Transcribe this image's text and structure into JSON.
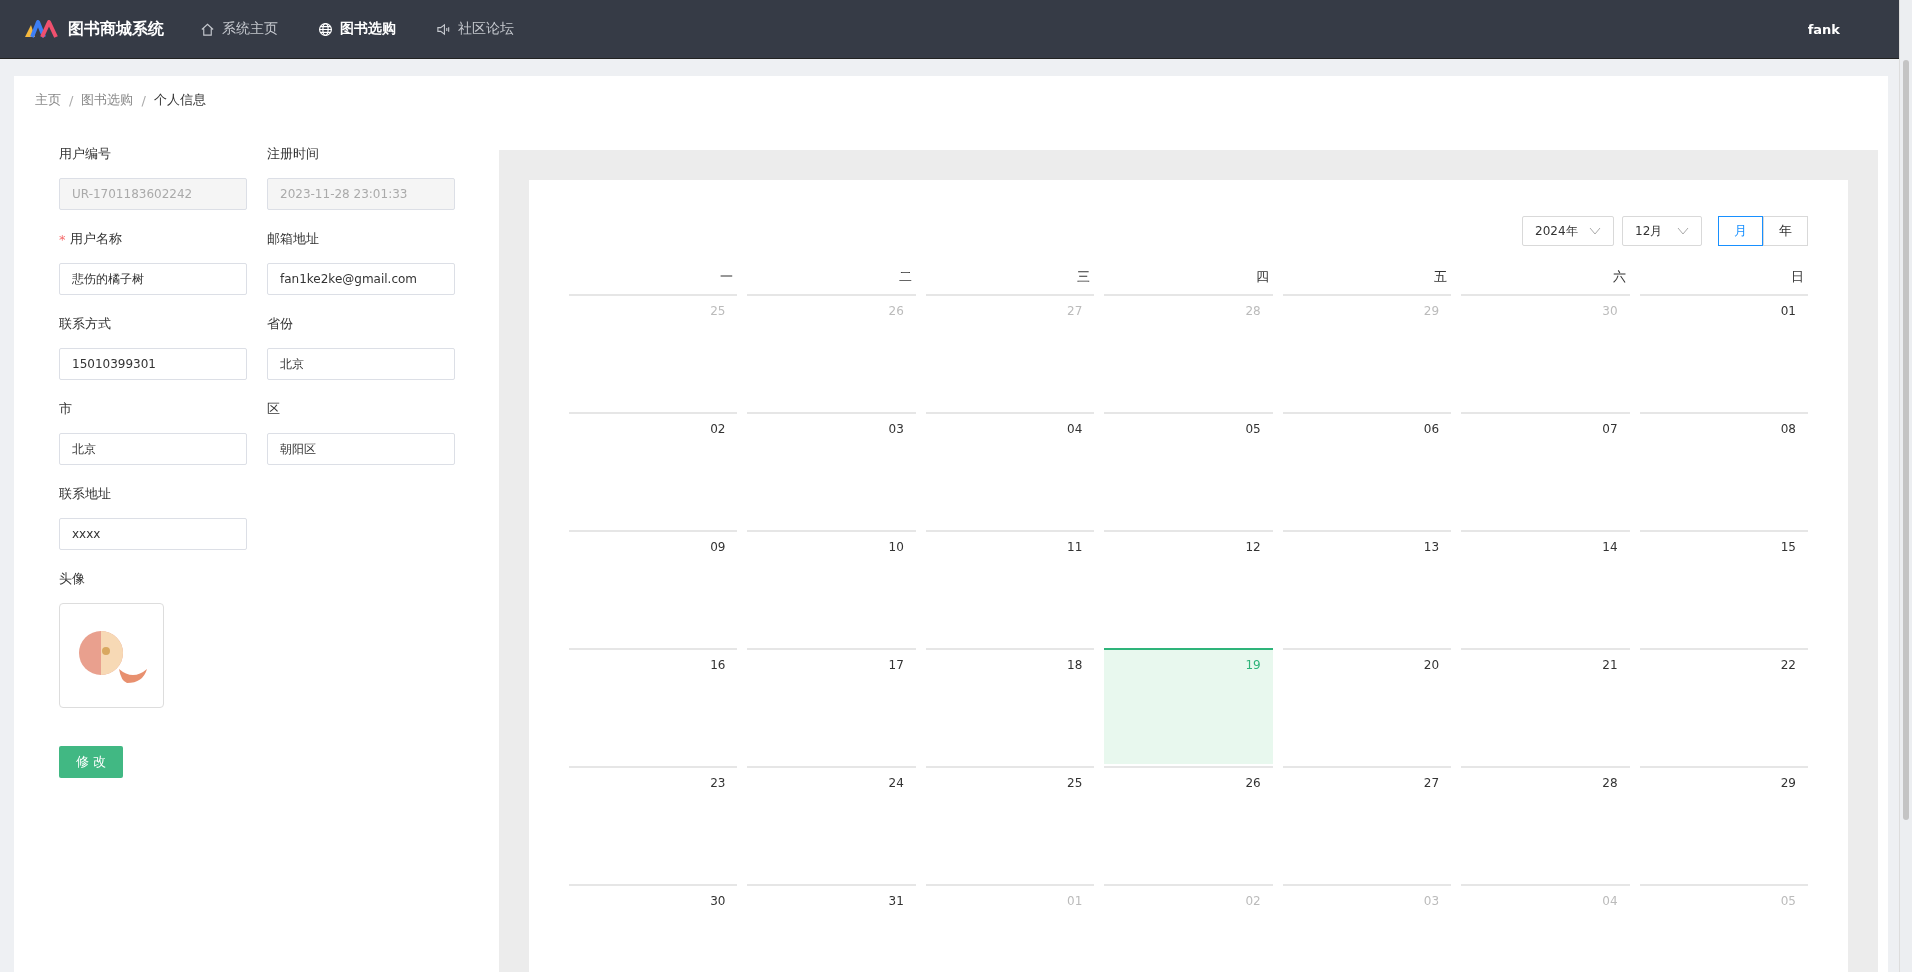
{
  "header": {
    "brand": "图书商城系统",
    "nav": [
      {
        "label": "系统主页",
        "selected": false
      },
      {
        "label": "图书选购",
        "selected": true
      },
      {
        "label": "社区论坛",
        "selected": false
      }
    ],
    "user": "fank"
  },
  "breadcrumb": {
    "items": [
      "主页",
      "图书选购",
      "个人信息"
    ],
    "separator": "/"
  },
  "form": {
    "required_mark": "*",
    "rows": [
      [
        {
          "label": "用户编号",
          "value": "UR-1701183602242",
          "disabled": true,
          "required": false
        },
        {
          "label": "注册时间",
          "value": "2023-11-28 23:01:33",
          "disabled": true,
          "required": false
        }
      ],
      [
        {
          "label": "用户名称",
          "value": "悲伤的橘子树",
          "disabled": false,
          "required": true
        },
        {
          "label": "邮箱地址",
          "value": "fan1ke2ke@gmail.com",
          "disabled": false,
          "required": false
        }
      ],
      [
        {
          "label": "联系方式",
          "value": "15010399301",
          "disabled": false,
          "required": false
        },
        {
          "label": "省份",
          "value": "北京",
          "disabled": false,
          "required": false
        }
      ],
      [
        {
          "label": "市",
          "value": "北京",
          "disabled": false,
          "required": false
        },
        {
          "label": "区",
          "value": "朝阳区",
          "disabled": false,
          "required": false
        }
      ],
      [
        {
          "label": "联系地址",
          "value": "xxxx",
          "disabled": false,
          "required": false
        }
      ]
    ],
    "avatar_label": "头像",
    "submit": "修 改"
  },
  "calendar": {
    "year": "2024年",
    "month": "12月",
    "modes": [
      {
        "label": "月",
        "selected": true
      },
      {
        "label": "年",
        "selected": false
      }
    ],
    "weekdays": [
      "一",
      "二",
      "三",
      "四",
      "五",
      "六",
      "日"
    ],
    "weeks": [
      [
        {
          "day": "25",
          "in_month": false,
          "selected": false
        },
        {
          "day": "26",
          "in_month": false,
          "selected": false
        },
        {
          "day": "27",
          "in_month": false,
          "selected": false
        },
        {
          "day": "28",
          "in_month": false,
          "selected": false
        },
        {
          "day": "29",
          "in_month": false,
          "selected": false
        },
        {
          "day": "30",
          "in_month": false,
          "selected": false
        },
        {
          "day": "01",
          "in_month": true,
          "selected": false
        }
      ],
      [
        {
          "day": "02",
          "in_month": true,
          "selected": false
        },
        {
          "day": "03",
          "in_month": true,
          "selected": false
        },
        {
          "day": "04",
          "in_month": true,
          "selected": false
        },
        {
          "day": "05",
          "in_month": true,
          "selected": false
        },
        {
          "day": "06",
          "in_month": true,
          "selected": false
        },
        {
          "day": "07",
          "in_month": true,
          "selected": false
        },
        {
          "day": "08",
          "in_month": true,
          "selected": false
        }
      ],
      [
        {
          "day": "09",
          "in_month": true,
          "selected": false
        },
        {
          "day": "10",
          "in_month": true,
          "selected": false
        },
        {
          "day": "11",
          "in_month": true,
          "selected": false
        },
        {
          "day": "12",
          "in_month": true,
          "selected": false
        },
        {
          "day": "13",
          "in_month": true,
          "selected": false
        },
        {
          "day": "14",
          "in_month": true,
          "selected": false
        },
        {
          "day": "15",
          "in_month": true,
          "selected": false
        }
      ],
      [
        {
          "day": "16",
          "in_month": true,
          "selected": false
        },
        {
          "day": "17",
          "in_month": true,
          "selected": false
        },
        {
          "day": "18",
          "in_month": true,
          "selected": false
        },
        {
          "day": "19",
          "in_month": true,
          "selected": true
        },
        {
          "day": "20",
          "in_month": true,
          "selected": false
        },
        {
          "day": "21",
          "in_month": true,
          "selected": false
        },
        {
          "day": "22",
          "in_month": true,
          "selected": false
        }
      ],
      [
        {
          "day": "23",
          "in_month": true,
          "selected": false
        },
        {
          "day": "24",
          "in_month": true,
          "selected": false
        },
        {
          "day": "25",
          "in_month": true,
          "selected": false
        },
        {
          "day": "26",
          "in_month": true,
          "selected": false
        },
        {
          "day": "27",
          "in_month": true,
          "selected": false
        },
        {
          "day": "28",
          "in_month": true,
          "selected": false
        },
        {
          "day": "29",
          "in_month": true,
          "selected": false
        }
      ],
      [
        {
          "day": "30",
          "in_month": true,
          "selected": false
        },
        {
          "day": "31",
          "in_month": true,
          "selected": false
        },
        {
          "day": "01",
          "in_month": false,
          "selected": false
        },
        {
          "day": "02",
          "in_month": false,
          "selected": false
        },
        {
          "day": "03",
          "in_month": false,
          "selected": false
        },
        {
          "day": "04",
          "in_month": false,
          "selected": false
        },
        {
          "day": "05",
          "in_month": false,
          "selected": false
        }
      ]
    ]
  }
}
